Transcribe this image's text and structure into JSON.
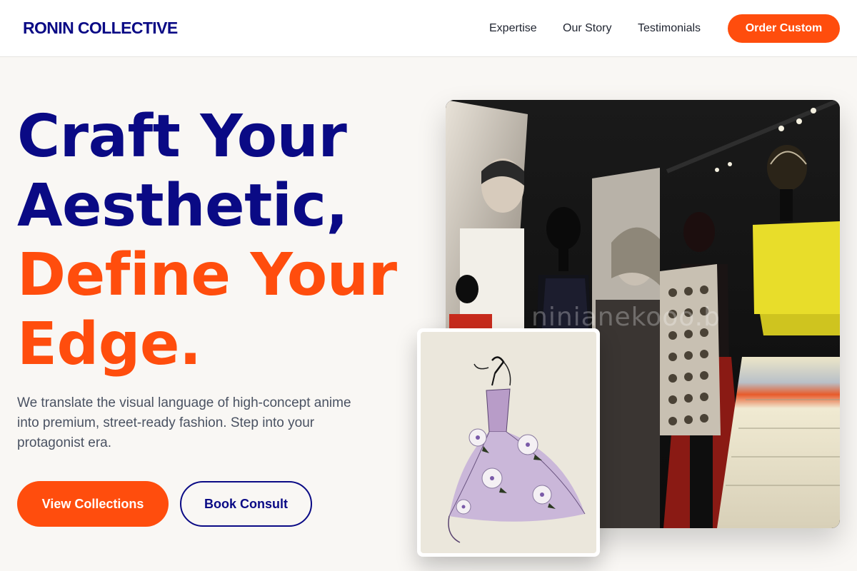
{
  "header": {
    "logo": "RONIN COLLECTIVE",
    "nav": [
      "Expertise",
      "Our Story",
      "Testimonials"
    ],
    "cta": "Order Custom"
  },
  "hero": {
    "headline_lines": [
      "Craft Your",
      "Aesthetic,",
      "Define Your",
      "Edge."
    ],
    "subtext": "We translate the visual language of high-concept anime into premium, street-ready fashion. Step into your protagonist era.",
    "primary_button": "View Collections",
    "secondary_button": "Book Consult"
  },
  "images": {
    "main_photo": "Fashion exhibition with mannequins",
    "main_photo_watermark": "ninianekooo.b",
    "sketch": "Watercolor sketch of a lilac gown with roses"
  },
  "colors": {
    "brand_navy": "#0a0a85",
    "accent_orange": "#ff4d0d",
    "background": "#f9f7f4",
    "body_text": "#4a5262"
  }
}
